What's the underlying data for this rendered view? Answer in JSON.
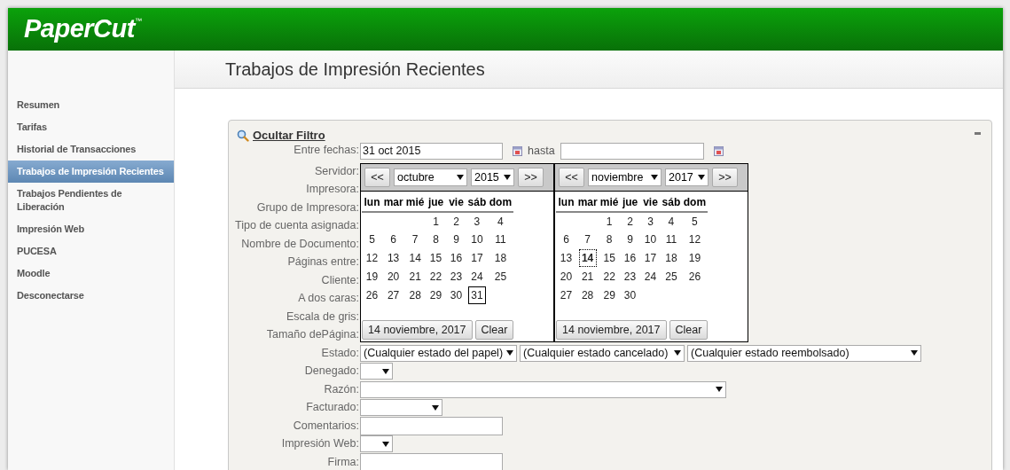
{
  "header": {
    "logo": "PaperCut",
    "logo_mark": "™"
  },
  "page_title": "Trabajos de Impresión Recientes",
  "sidebar": {
    "items": [
      {
        "label": "Resumen",
        "selected": false
      },
      {
        "label": "Tarifas",
        "selected": false
      },
      {
        "label": "Historial de Transacciones",
        "selected": false
      },
      {
        "label": "Trabajos de Impresión Recientes",
        "selected": true
      },
      {
        "label": "Trabajos Pendientes de Liberación",
        "selected": false
      },
      {
        "label": "Impresión Web",
        "selected": false
      },
      {
        "label": "PUCESA",
        "selected": false
      },
      {
        "label": "Moodle",
        "selected": false
      },
      {
        "label": "Desconectarse",
        "selected": false
      }
    ]
  },
  "filter": {
    "toggle_label": "Ocultar Filtro",
    "date_range": {
      "label": "Entre fechas:",
      "from_value": "31 oct 2015",
      "separator": "hasta"
    },
    "calendars": [
      {
        "prev": "<<",
        "month": "octubre",
        "year": "2015",
        "next": ">>",
        "weekdays": [
          "lun",
          "mar",
          "mié",
          "jue",
          "vie",
          "sáb",
          "dom"
        ],
        "weeks": [
          {
            "days": [
              {
                "d": "1",
                "selected": false,
                "today": false
              },
              {
                "d": "2",
                "selected": false,
                "today": false
              },
              {
                "d": "3",
                "selected": false,
                "today": false
              },
              {
                "d": "4",
                "selected": false,
                "today": false
              }
            ]
          },
          {
            "days": [
              {
                "d": "5",
                "selected": false,
                "today": false
              },
              {
                "d": "6",
                "selected": false,
                "today": false
              },
              {
                "d": "7",
                "selected": false,
                "today": false
              },
              {
                "d": "8",
                "selected": false,
                "today": false
              },
              {
                "d": "9",
                "selected": false,
                "today": false
              },
              {
                "d": "10",
                "selected": false,
                "today": false
              },
              {
                "d": "11",
                "selected": false,
                "today": false
              }
            ]
          },
          {
            "days": [
              {
                "d": "12",
                "selected": false,
                "today": false
              },
              {
                "d": "13",
                "selected": false,
                "today": false
              },
              {
                "d": "14",
                "selected": false,
                "today": false
              },
              {
                "d": "15",
                "selected": false,
                "today": false
              },
              {
                "d": "16",
                "selected": false,
                "today": false
              },
              {
                "d": "17",
                "selected": false,
                "today": false
              },
              {
                "d": "18",
                "selected": false,
                "today": false
              }
            ]
          },
          {
            "days": [
              {
                "d": "19",
                "selected": false,
                "today": false
              },
              {
                "d": "20",
                "selected": false,
                "today": false
              },
              {
                "d": "21",
                "selected": false,
                "today": false
              },
              {
                "d": "22",
                "selected": false,
                "today": false
              },
              {
                "d": "23",
                "selected": false,
                "today": false
              },
              {
                "d": "24",
                "selected": false,
                "today": false
              },
              {
                "d": "25",
                "selected": false,
                "today": false
              }
            ]
          },
          {
            "days": [
              {
                "d": "26",
                "selected": false,
                "today": false
              },
              {
                "d": "27",
                "selected": false,
                "today": false
              },
              {
                "d": "28",
                "selected": false,
                "today": false
              },
              {
                "d": "29",
                "selected": false,
                "today": false
              },
              {
                "d": "30",
                "selected": false,
                "today": false
              },
              {
                "d": "31",
                "selected": true,
                "today": false
              }
            ]
          }
        ],
        "today_button": "14 noviembre, 2017",
        "clear_button": "Clear"
      },
      {
        "prev": "<<",
        "month": "noviembre",
        "year": "2017",
        "next": ">>",
        "weekdays": [
          "lun",
          "mar",
          "mié",
          "jue",
          "vie",
          "sáb",
          "dom"
        ],
        "weeks": [
          {
            "days": [
              {
                "d": "1",
                "selected": false,
                "today": false
              },
              {
                "d": "2",
                "selected": false,
                "today": false
              },
              {
                "d": "3",
                "selected": false,
                "today": false
              },
              {
                "d": "4",
                "selected": false,
                "today": false
              },
              {
                "d": "5",
                "selected": false,
                "today": false
              }
            ]
          },
          {
            "days": [
              {
                "d": "6",
                "selected": false,
                "today": false
              },
              {
                "d": "7",
                "selected": false,
                "today": false
              },
              {
                "d": "8",
                "selected": false,
                "today": false
              },
              {
                "d": "9",
                "selected": false,
                "today": false
              },
              {
                "d": "10",
                "selected": false,
                "today": false
              },
              {
                "d": "11",
                "selected": false,
                "today": false
              },
              {
                "d": "12",
                "selected": false,
                "today": false
              }
            ]
          },
          {
            "days": [
              {
                "d": "13",
                "selected": false,
                "today": false
              },
              {
                "d": "14",
                "selected": false,
                "today": true
              },
              {
                "d": "15",
                "selected": false,
                "today": false
              },
              {
                "d": "16",
                "selected": false,
                "today": false
              },
              {
                "d": "17",
                "selected": false,
                "today": false
              },
              {
                "d": "18",
                "selected": false,
                "today": false
              },
              {
                "d": "19",
                "selected": false,
                "today": false
              }
            ]
          },
          {
            "days": [
              {
                "d": "20",
                "selected": false,
                "today": false
              },
              {
                "d": "21",
                "selected": false,
                "today": false
              },
              {
                "d": "22",
                "selected": false,
                "today": false
              },
              {
                "d": "23",
                "selected": false,
                "today": false
              },
              {
                "d": "24",
                "selected": false,
                "today": false
              },
              {
                "d": "25",
                "selected": false,
                "today": false
              },
              {
                "d": "26",
                "selected": false,
                "today": false
              }
            ]
          },
          {
            "days": [
              {
                "d": "27",
                "selected": false,
                "today": false
              },
              {
                "d": "28",
                "selected": false,
                "today": false
              },
              {
                "d": "29",
                "selected": false,
                "today": false
              },
              {
                "d": "30",
                "selected": false,
                "today": false
              }
            ]
          }
        ],
        "today_button": "14 noviembre, 2017",
        "clear_button": "Clear"
      }
    ],
    "rows": [
      {
        "label": "Servidor:",
        "fields": []
      },
      {
        "label": "Impresora:",
        "fields": []
      },
      {
        "label": "Grupo de Impresora:",
        "fields": []
      },
      {
        "label": "Tipo de cuenta asignada:",
        "fields": []
      },
      {
        "label": "Nombre de Documento:",
        "fields": []
      },
      {
        "label": "Páginas entre:",
        "fields": []
      },
      {
        "label": "Cliente:",
        "fields": []
      },
      {
        "label": "A dos caras:",
        "fields": []
      },
      {
        "label": "Escala de gris:",
        "fields": []
      },
      {
        "label": "Tamaño dePágina:",
        "fields": []
      },
      {
        "label": "Estado:",
        "fields": [
          {
            "kind": "select",
            "value": "(Cualquier estado del papel)"
          },
          {
            "kind": "select",
            "value": "(Cualquier estado cancelado)"
          },
          {
            "kind": "select",
            "value": "(Cualquier estado reembolsado)"
          }
        ]
      },
      {
        "label": "Denegado:",
        "fields": [
          {
            "kind": "select"
          }
        ]
      },
      {
        "label": "Razón:",
        "fields": [
          {
            "kind": "select"
          }
        ]
      },
      {
        "label": "Facturado:",
        "fields": [
          {
            "kind": "select"
          }
        ]
      },
      {
        "label": "Comentarios:",
        "fields": [
          {
            "kind": "text"
          }
        ]
      },
      {
        "label": "Impresión Web:",
        "fields": [
          {
            "kind": "select"
          }
        ]
      },
      {
        "label": "Firma:",
        "fields": [
          {
            "kind": "text"
          }
        ]
      }
    ]
  }
}
